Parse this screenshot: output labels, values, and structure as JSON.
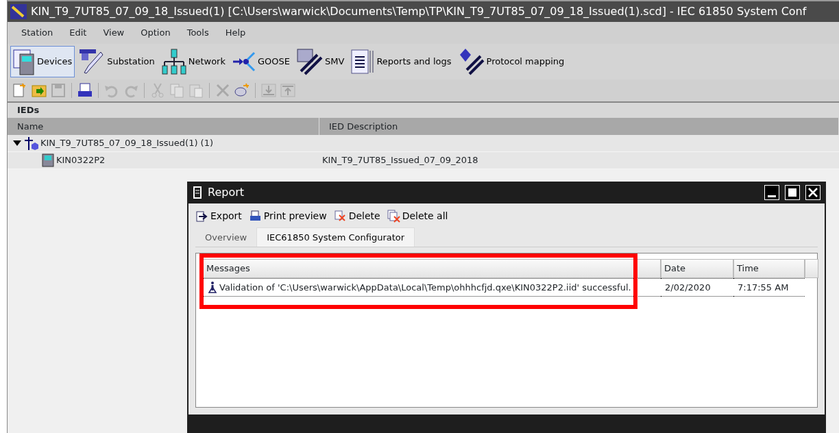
{
  "window": {
    "title": "KIN_T9_7UT85_07_09_18_Issued(1) [C:\\Users\\warwick\\Documents\\Temp\\TP\\KIN_T9_7UT85_07_09_18_Issued(1).scd] - IEC 61850 System Conf"
  },
  "menu": [
    "Station",
    "Edit",
    "View",
    "Option",
    "Tools",
    "Help"
  ],
  "views": [
    {
      "label": "Devices",
      "selected": true
    },
    {
      "label": "Substation",
      "selected": false
    },
    {
      "label": "Network",
      "selected": false
    },
    {
      "label": "GOOSE",
      "selected": false
    },
    {
      "label": "SMV",
      "selected": false
    },
    {
      "label": "Reports and logs",
      "selected": false
    },
    {
      "label": "Protocol mapping",
      "selected": false
    }
  ],
  "toolbar": [
    [
      {
        "disabled": false
      },
      {
        "disabled": false
      },
      {
        "disabled": true
      }
    ],
    [
      {
        "disabled": false
      }
    ],
    [
      {
        "disabled": true
      },
      {
        "disabled": true
      }
    ],
    [
      {
        "disabled": true
      },
      {
        "disabled": true
      },
      {
        "disabled": true
      }
    ],
    [
      {
        "disabled": true
      },
      {
        "disabled": false
      }
    ],
    [
      {
        "disabled": true
      },
      {
        "disabled": true
      }
    ]
  ],
  "ieds": {
    "title": "IEDs",
    "columns": [
      "Name",
      "IED Description"
    ],
    "rows": [
      {
        "name": "KIN_T9_7UT85_07_09_18_Issued(1) (1)",
        "expanded": true,
        "children": [
          {
            "name": "KIN0322P2",
            "description": "KIN_T9_7UT85_Issued_07_09_2018"
          }
        ]
      }
    ]
  },
  "report": {
    "title": "Report",
    "actions": [
      "Export",
      "Print preview",
      "Delete",
      "Delete all"
    ],
    "tabs": [
      {
        "label": "Overview",
        "selected": false
      },
      {
        "label": "IEC61850 System Configurator",
        "selected": true
      }
    ],
    "columns": [
      "Messages",
      "Date",
      "Time"
    ],
    "rows": [
      {
        "message": "Validation of 'C:\\Users\\warwick\\AppData\\Local\\Temp\\ohhhcfjd.qxe\\KIN0322P2.iid' successful.",
        "date": "2/02/2020",
        "time": "7:17:55 AM",
        "selected": true
      }
    ]
  },
  "annotation": {
    "kind": "highlight",
    "color": "#ff0000"
  }
}
